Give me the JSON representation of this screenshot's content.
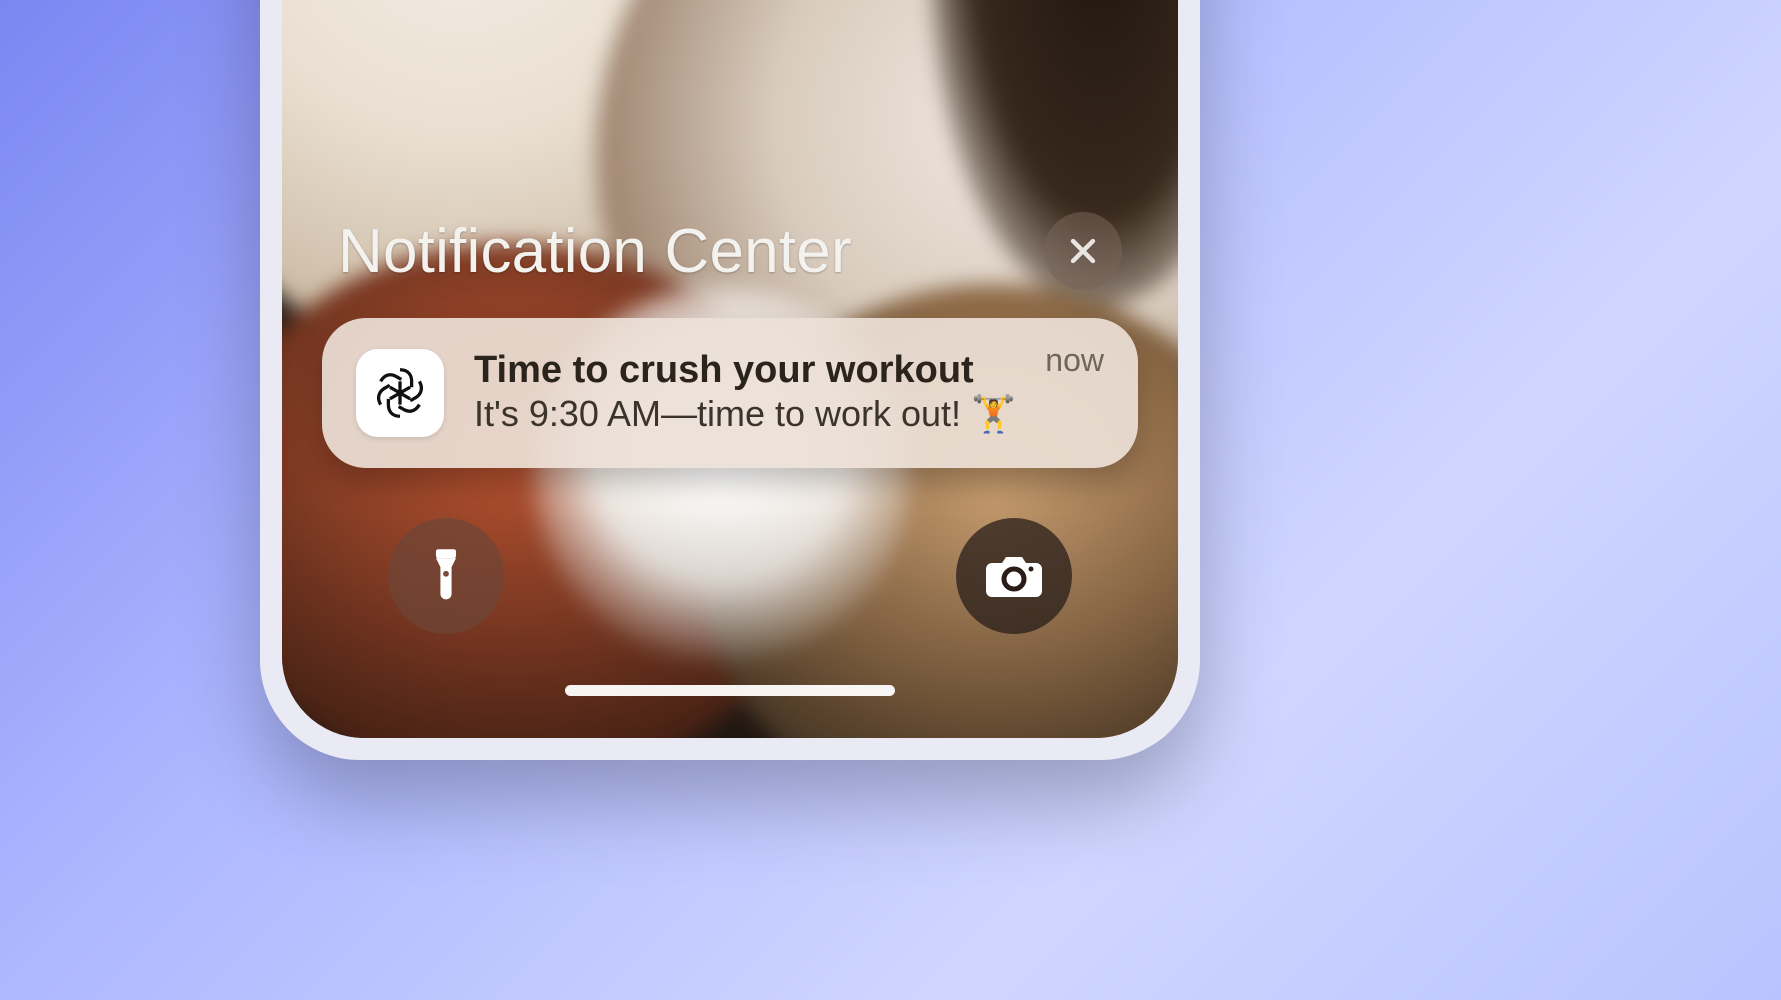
{
  "notification_center": {
    "title": "Notification Center",
    "dismiss_icon": "x-icon"
  },
  "notification": {
    "app_icon": "openai-logo",
    "title": "Time to crush your workout",
    "body": "It's 9:30 AM—time to work out! 🏋️",
    "truncation": "...",
    "timestamp": "now"
  },
  "quick_actions": {
    "flashlight_icon": "flashlight-icon",
    "camera_icon": "camera-icon"
  }
}
